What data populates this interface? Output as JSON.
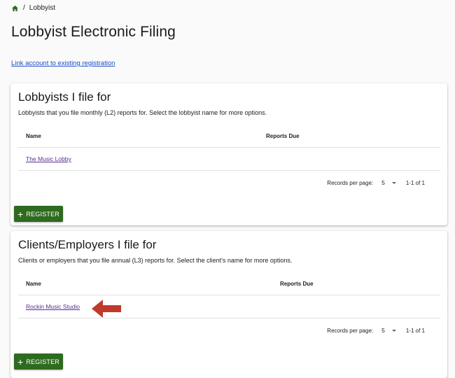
{
  "breadcrumb": {
    "separator": "/",
    "current": "Lobbyist"
  },
  "page_title": "Lobbyist Electronic Filing",
  "link_account": "Link account to existing registration",
  "colors": {
    "primary_green": "#2e6b1f",
    "link_purple": "#5a2d91",
    "link_blue": "#1a4fc4",
    "annotation_arrow": "#c0392b"
  },
  "lobbyists": {
    "title": "Lobbyists I file for",
    "subtitle": "Lobbyists that you file monthly (L2) reports for. Select the lobbyist name for more options.",
    "columns": [
      "Name",
      "Reports Due"
    ],
    "rows": [
      {
        "name": "The Music Lobby",
        "reports_due": ""
      }
    ],
    "pagination": {
      "label": "Records per page:",
      "per_page": "5",
      "range": "1-1 of 1"
    },
    "register_label": "REGISTER"
  },
  "clients": {
    "title": "Clients/Employers I file for",
    "subtitle": "Clients or employers that you file annual (L3) reports for. Select the client's name for more options.",
    "columns": [
      "Name",
      "Reports Due"
    ],
    "rows": [
      {
        "name": "Rockin Music Studio",
        "reports_due": ""
      }
    ],
    "pagination": {
      "label": "Records per page:",
      "per_page": "5",
      "range": "1-1 of 1"
    },
    "register_label": "REGISTER"
  }
}
